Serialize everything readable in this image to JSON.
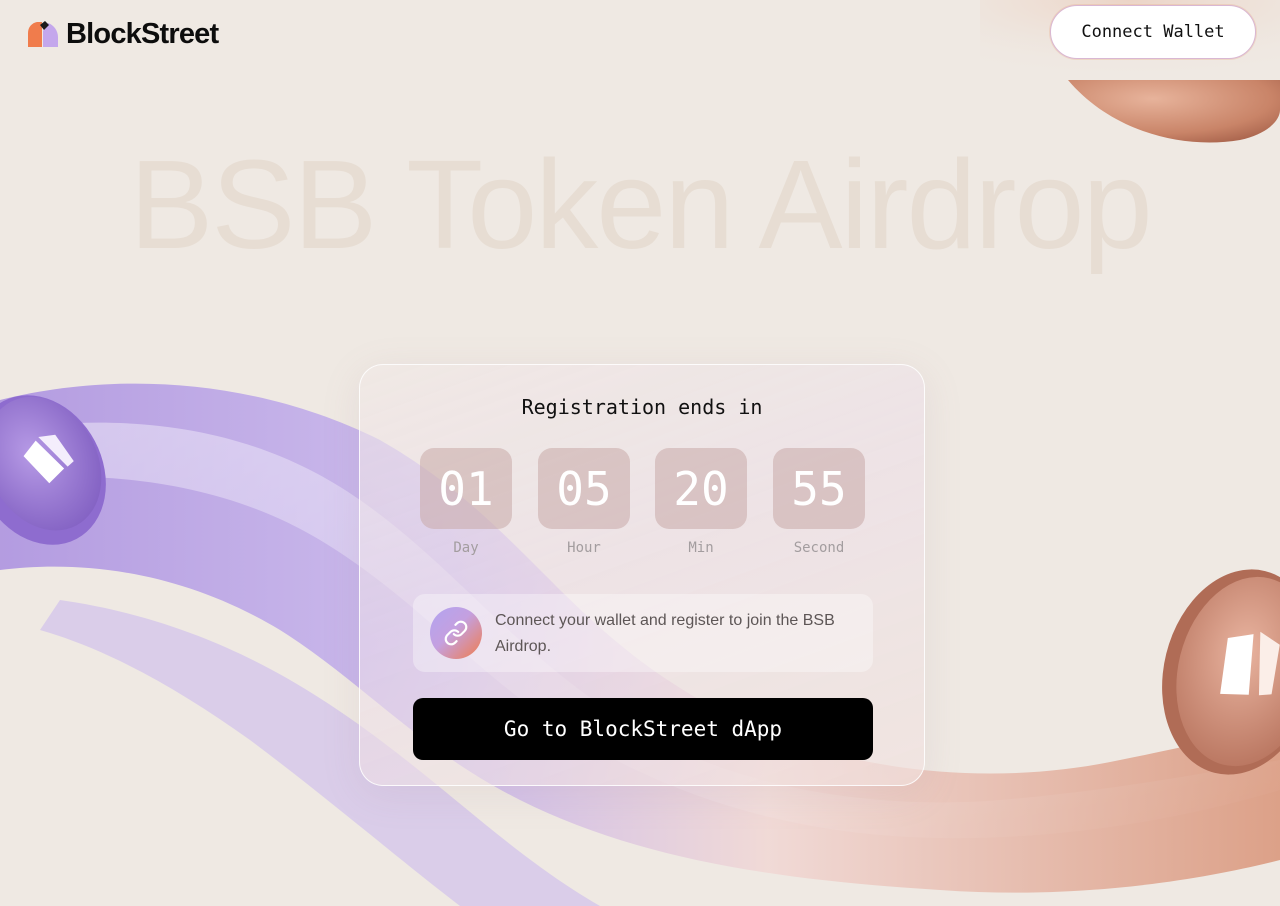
{
  "header": {
    "brand": "BlockStreet",
    "connect_wallet_label": "Connect Wallet"
  },
  "hero": {
    "title": "BSB Token Airdrop"
  },
  "card": {
    "title": "Registration ends in",
    "countdown": [
      {
        "value": "01",
        "label": "Day"
      },
      {
        "value": "05",
        "label": "Hour"
      },
      {
        "value": "20",
        "label": "Min"
      },
      {
        "value": "55",
        "label": "Second"
      }
    ],
    "info_text": "Connect your wallet and register to join the BSB Airdrop.",
    "info_icon": "link-icon",
    "cta_label": "Go to BlockStreet dApp"
  },
  "colors": {
    "background": "#efe9e3",
    "primary_button": "#000000",
    "accent_orange": "#f07c4c",
    "accent_purple": "#b2a4f0"
  }
}
